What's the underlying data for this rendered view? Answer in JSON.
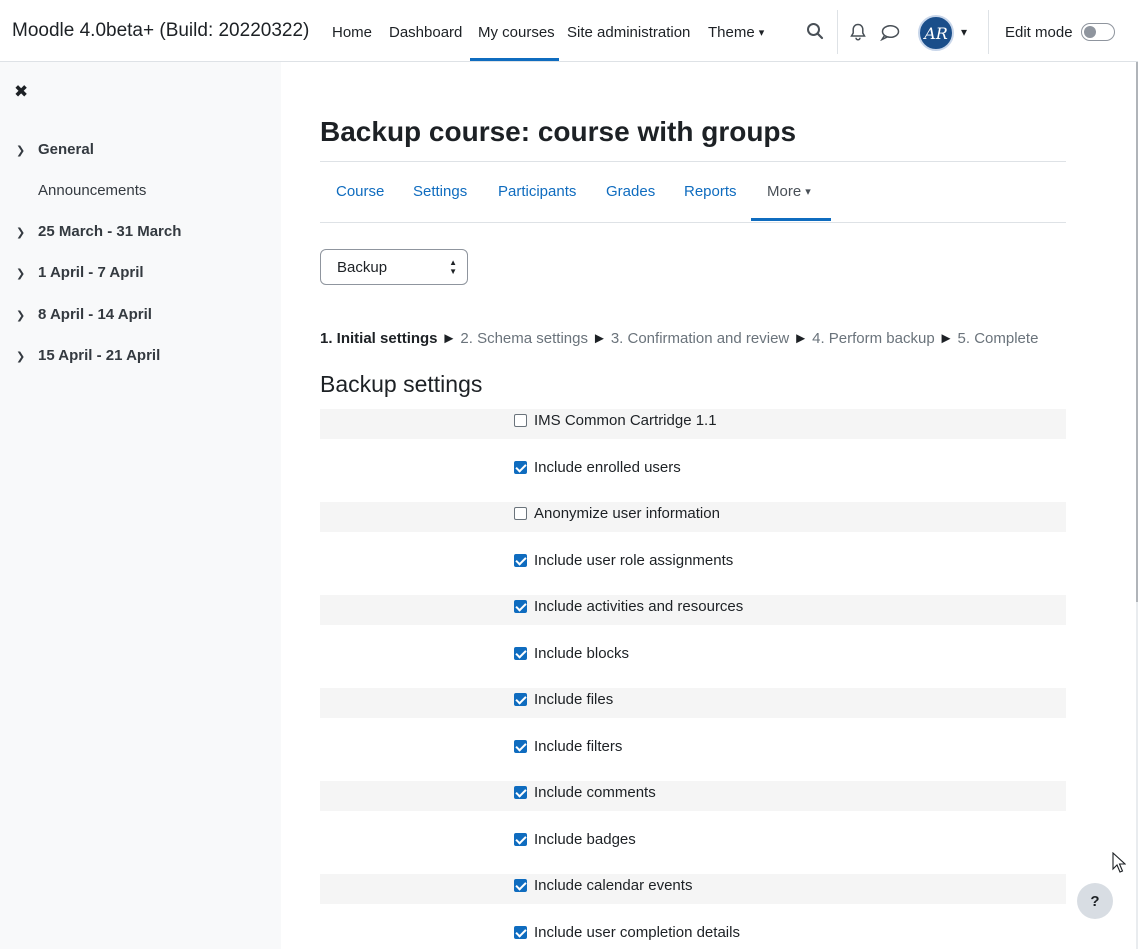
{
  "navbar": {
    "site_name": "Moodle 4.0beta+ (Build: 20220322)",
    "links": [
      "Home",
      "Dashboard",
      "My courses",
      "Site administration",
      "Theme"
    ],
    "active_link": "My courses",
    "avatar_initials": "AR",
    "edit_mode_label": "Edit mode",
    "edit_mode_on": false,
    "icons": [
      "search-icon",
      "bell-icon",
      "message-icon",
      "chevron-down-icon"
    ]
  },
  "drawer": {
    "sections": [
      {
        "label": "General",
        "activities": [
          "Announcements"
        ]
      },
      {
        "label": "25 March - 31 March"
      },
      {
        "label": "1 April - 7 April"
      },
      {
        "label": "8 April - 14 April"
      },
      {
        "label": "15 April - 21 April"
      }
    ]
  },
  "page": {
    "title": "Backup course: course with groups",
    "secondary_nav": [
      "Course",
      "Settings",
      "Participants",
      "Grades",
      "Reports",
      "More"
    ],
    "secondary_active": "More",
    "select_value": "Backup",
    "progress": {
      "steps": [
        "1. Initial settings",
        "2. Schema settings",
        "3. Confirmation and review",
        "4. Perform backup",
        "5. Complete"
      ],
      "separator": "►",
      "current": 0
    },
    "settings_heading": "Backup settings",
    "settings": [
      {
        "label": "IMS Common Cartridge 1.1",
        "checked": false
      },
      {
        "label": "Include enrolled users",
        "checked": true
      },
      {
        "label": "Anonymize user information",
        "checked": false
      },
      {
        "label": "Include user role assignments",
        "checked": true
      },
      {
        "label": "Include activities and resources",
        "checked": true
      },
      {
        "label": "Include blocks",
        "checked": true
      },
      {
        "label": "Include files",
        "checked": true
      },
      {
        "label": "Include filters",
        "checked": true
      },
      {
        "label": "Include comments",
        "checked": true
      },
      {
        "label": "Include badges",
        "checked": true
      },
      {
        "label": "Include calendar events",
        "checked": true
      },
      {
        "label": "Include user completion details",
        "checked": true
      }
    ]
  },
  "help_button": "?"
}
